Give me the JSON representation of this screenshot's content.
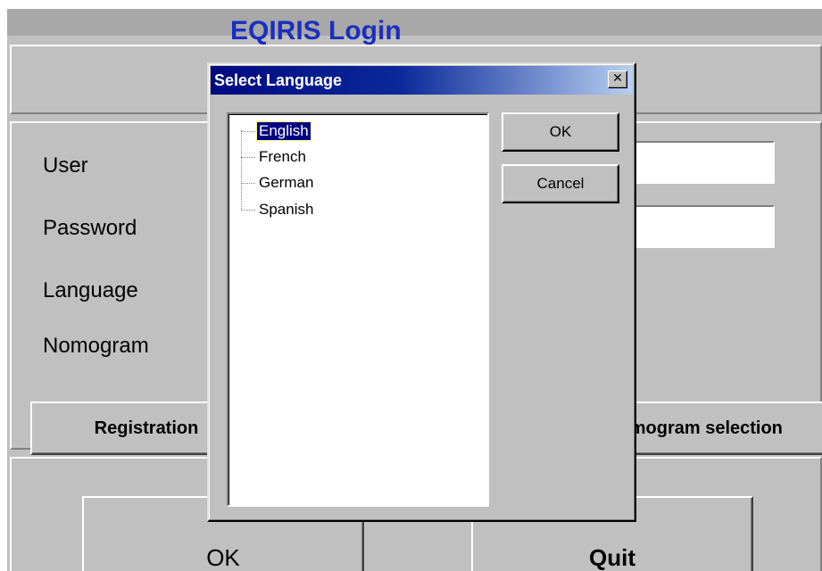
{
  "main_window": {
    "app_title": "EQIRIS Login",
    "labels": {
      "user": "User",
      "password": "Password",
      "language": "Language",
      "nomogram": "Nomogram"
    },
    "fields": {
      "user_value": "",
      "password_value": ""
    },
    "buttons": {
      "registration": "Registration",
      "nomogram_selection": "Nomogram selection",
      "ok": "OK",
      "quit": "Quit"
    }
  },
  "dialog": {
    "title": "Select Language",
    "close_glyph": "✕",
    "languages": [
      {
        "label": "English",
        "selected": true
      },
      {
        "label": "French",
        "selected": false
      },
      {
        "label": "German",
        "selected": false
      },
      {
        "label": "Spanish",
        "selected": false
      }
    ],
    "ok_label": "OK",
    "cancel_label": "Cancel"
  },
  "colors": {
    "window_face": "#c0c0c0",
    "app_title_blue": "#1a2fbf",
    "dialog_title_dark": "#000a80",
    "dialog_title_light": "#b8cff0",
    "selection": "#000080"
  }
}
